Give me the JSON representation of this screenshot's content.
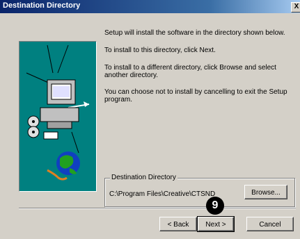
{
  "window": {
    "title": "Destination Directory",
    "close_glyph": "X"
  },
  "messages": [
    "Setup will install the software in the directory shown below.",
    "To install to this directory, click Next.",
    "To install to a different directory, click Browse and select another directory.",
    "You can choose not to install by cancelling to exit the Setup program."
  ],
  "destination": {
    "group_label": "Destination Directory",
    "path": "C:\\Program Files\\Creative\\CTSND",
    "browse_label": "Browse..."
  },
  "buttons": {
    "back": "< Back",
    "next": "Next >",
    "cancel": "Cancel"
  },
  "badge": {
    "number": "9"
  },
  "colors": {
    "titlebar": "#0a246a",
    "panel": "#008080",
    "face": "#d4d0c8"
  }
}
